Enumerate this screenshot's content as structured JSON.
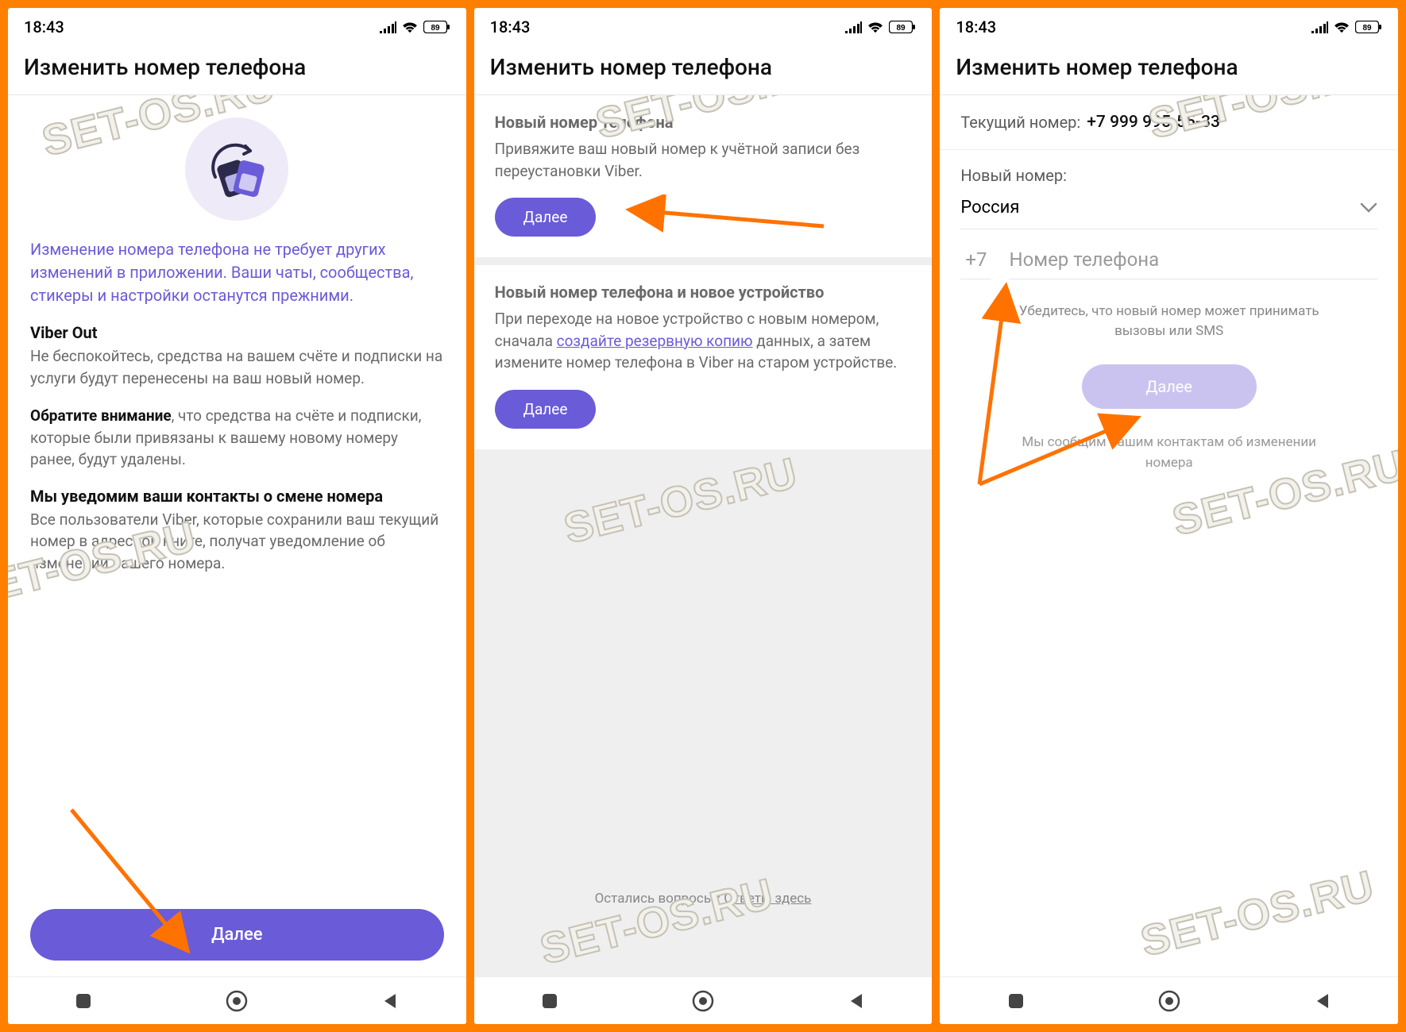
{
  "status": {
    "time": "18:43",
    "battery": "89"
  },
  "header_title": "Изменить номер телефона",
  "watermark": "SET-OS.RU",
  "screen1": {
    "intro": "Изменение номера телефона не требует других изменений в приложении. Ваши чаты, сообщества, стикеры и настройки останутся прежними.",
    "s1_title": "Viber Out",
    "s1_text": "Не беспокойтесь, средства на вашем счёте и подписки на услуги будут перенесены на ваш новый номер.",
    "s2_bold": "Обратите внимание",
    "s2_rest": ", что средства на счёте и подписки, которые были привязаны к вашему новому номеру ранее, будут удалены.",
    "s3_title": "Мы уведомим ваши контакты о смене номера",
    "s3_text": "Все пользователи Viber, которые сохранили ваш текущий номер в адресной книге, получат уведомление об изменении вашего номера.",
    "next": "Далее"
  },
  "screen2": {
    "b1_title": "Новый номер телефона",
    "b1_text": "Привяжите ваш новый номер к учётной записи без переустановки Viber.",
    "b2_title": "Новый номер телефона и новое устройство",
    "b2_pre": "При переходе на новое устройство с новым номером, сначала ",
    "b2_link": "создайте резервную копию",
    "b2_post": " данных, а затем измените номер телефона в Viber на старом устройстве.",
    "next": "Далее",
    "answers_pre": "Остались вопросы? ",
    "answers_link": "Ответы здесь"
  },
  "screen3": {
    "current_label": "Текущий номер:",
    "current_value": "+7 999 995-55-33",
    "new_label": "Новый номер:",
    "country": "Россия",
    "prefix": "+7",
    "placeholder": "Номер телефона",
    "hint": "Убедитесь, что новый номер может принимать вызовы или SMS",
    "next": "Далее",
    "notice": "Мы сообщим вашим контактам об изменении номера"
  }
}
